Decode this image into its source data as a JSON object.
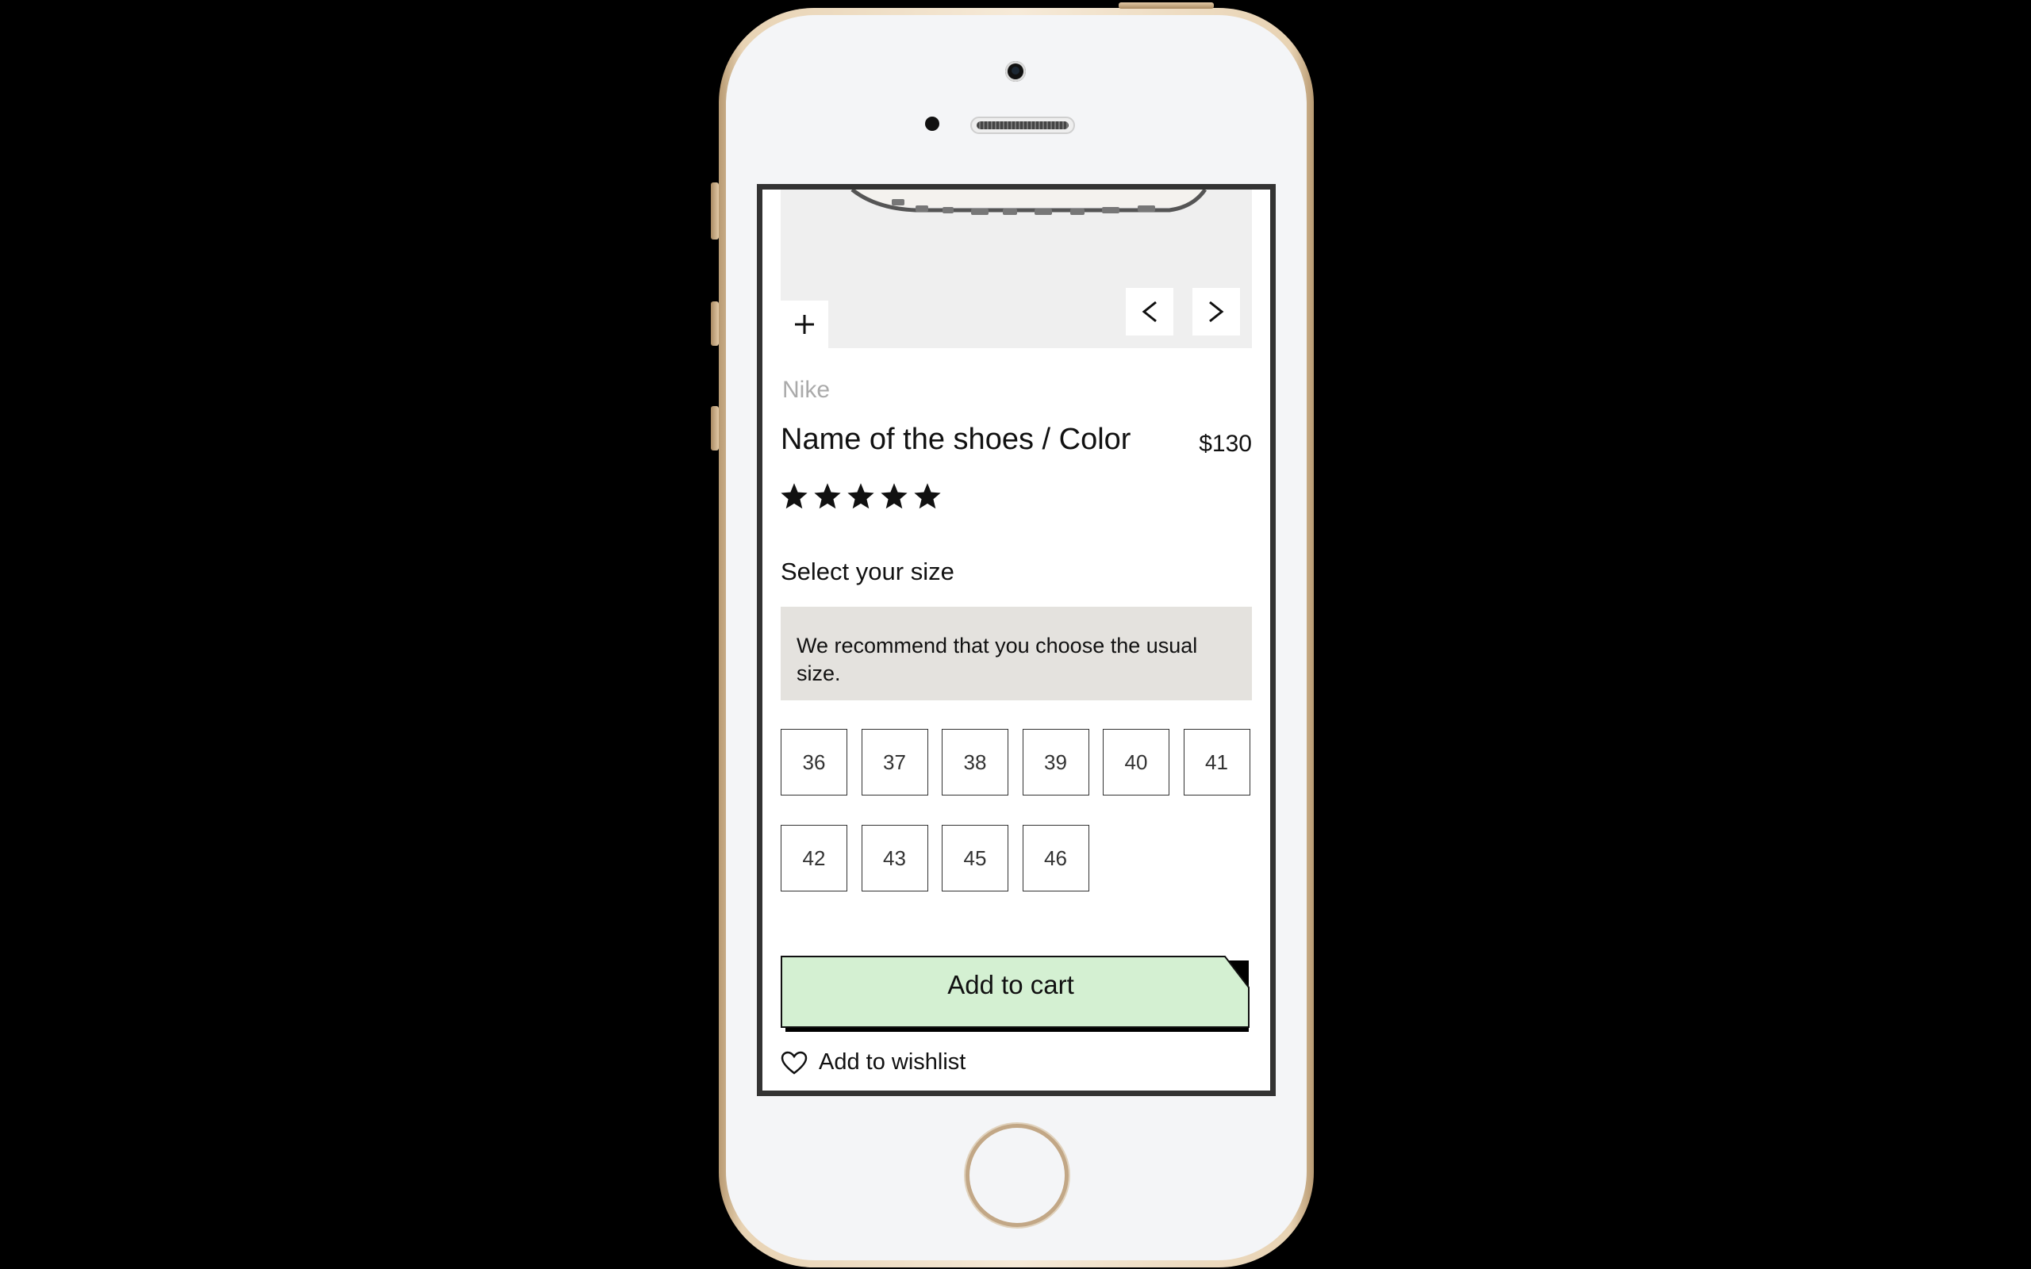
{
  "product": {
    "brand": "Nike",
    "title": "Name of the shoes / Color",
    "price": "$130",
    "rating": 5,
    "rating_max": 5
  },
  "gallery": {
    "zoom_icon": "plus-icon",
    "prev_icon": "chevron-left-icon",
    "next_icon": "chevron-right-icon"
  },
  "size": {
    "label": "Select your size",
    "recommendation": "We recommend that you choose the usual size.",
    "options": [
      "36",
      "37",
      "38",
      "39",
      "40",
      "41",
      "42",
      "43",
      "45",
      "46"
    ]
  },
  "actions": {
    "add_to_cart": "Add to cart",
    "add_to_wishlist": "Add to wishlist",
    "wishlist_icon": "heart-icon"
  },
  "colors": {
    "cart_button": "#d4f0d2",
    "recommendation_bg": "#e4e2de",
    "brand_text": "#aaaaaa"
  }
}
